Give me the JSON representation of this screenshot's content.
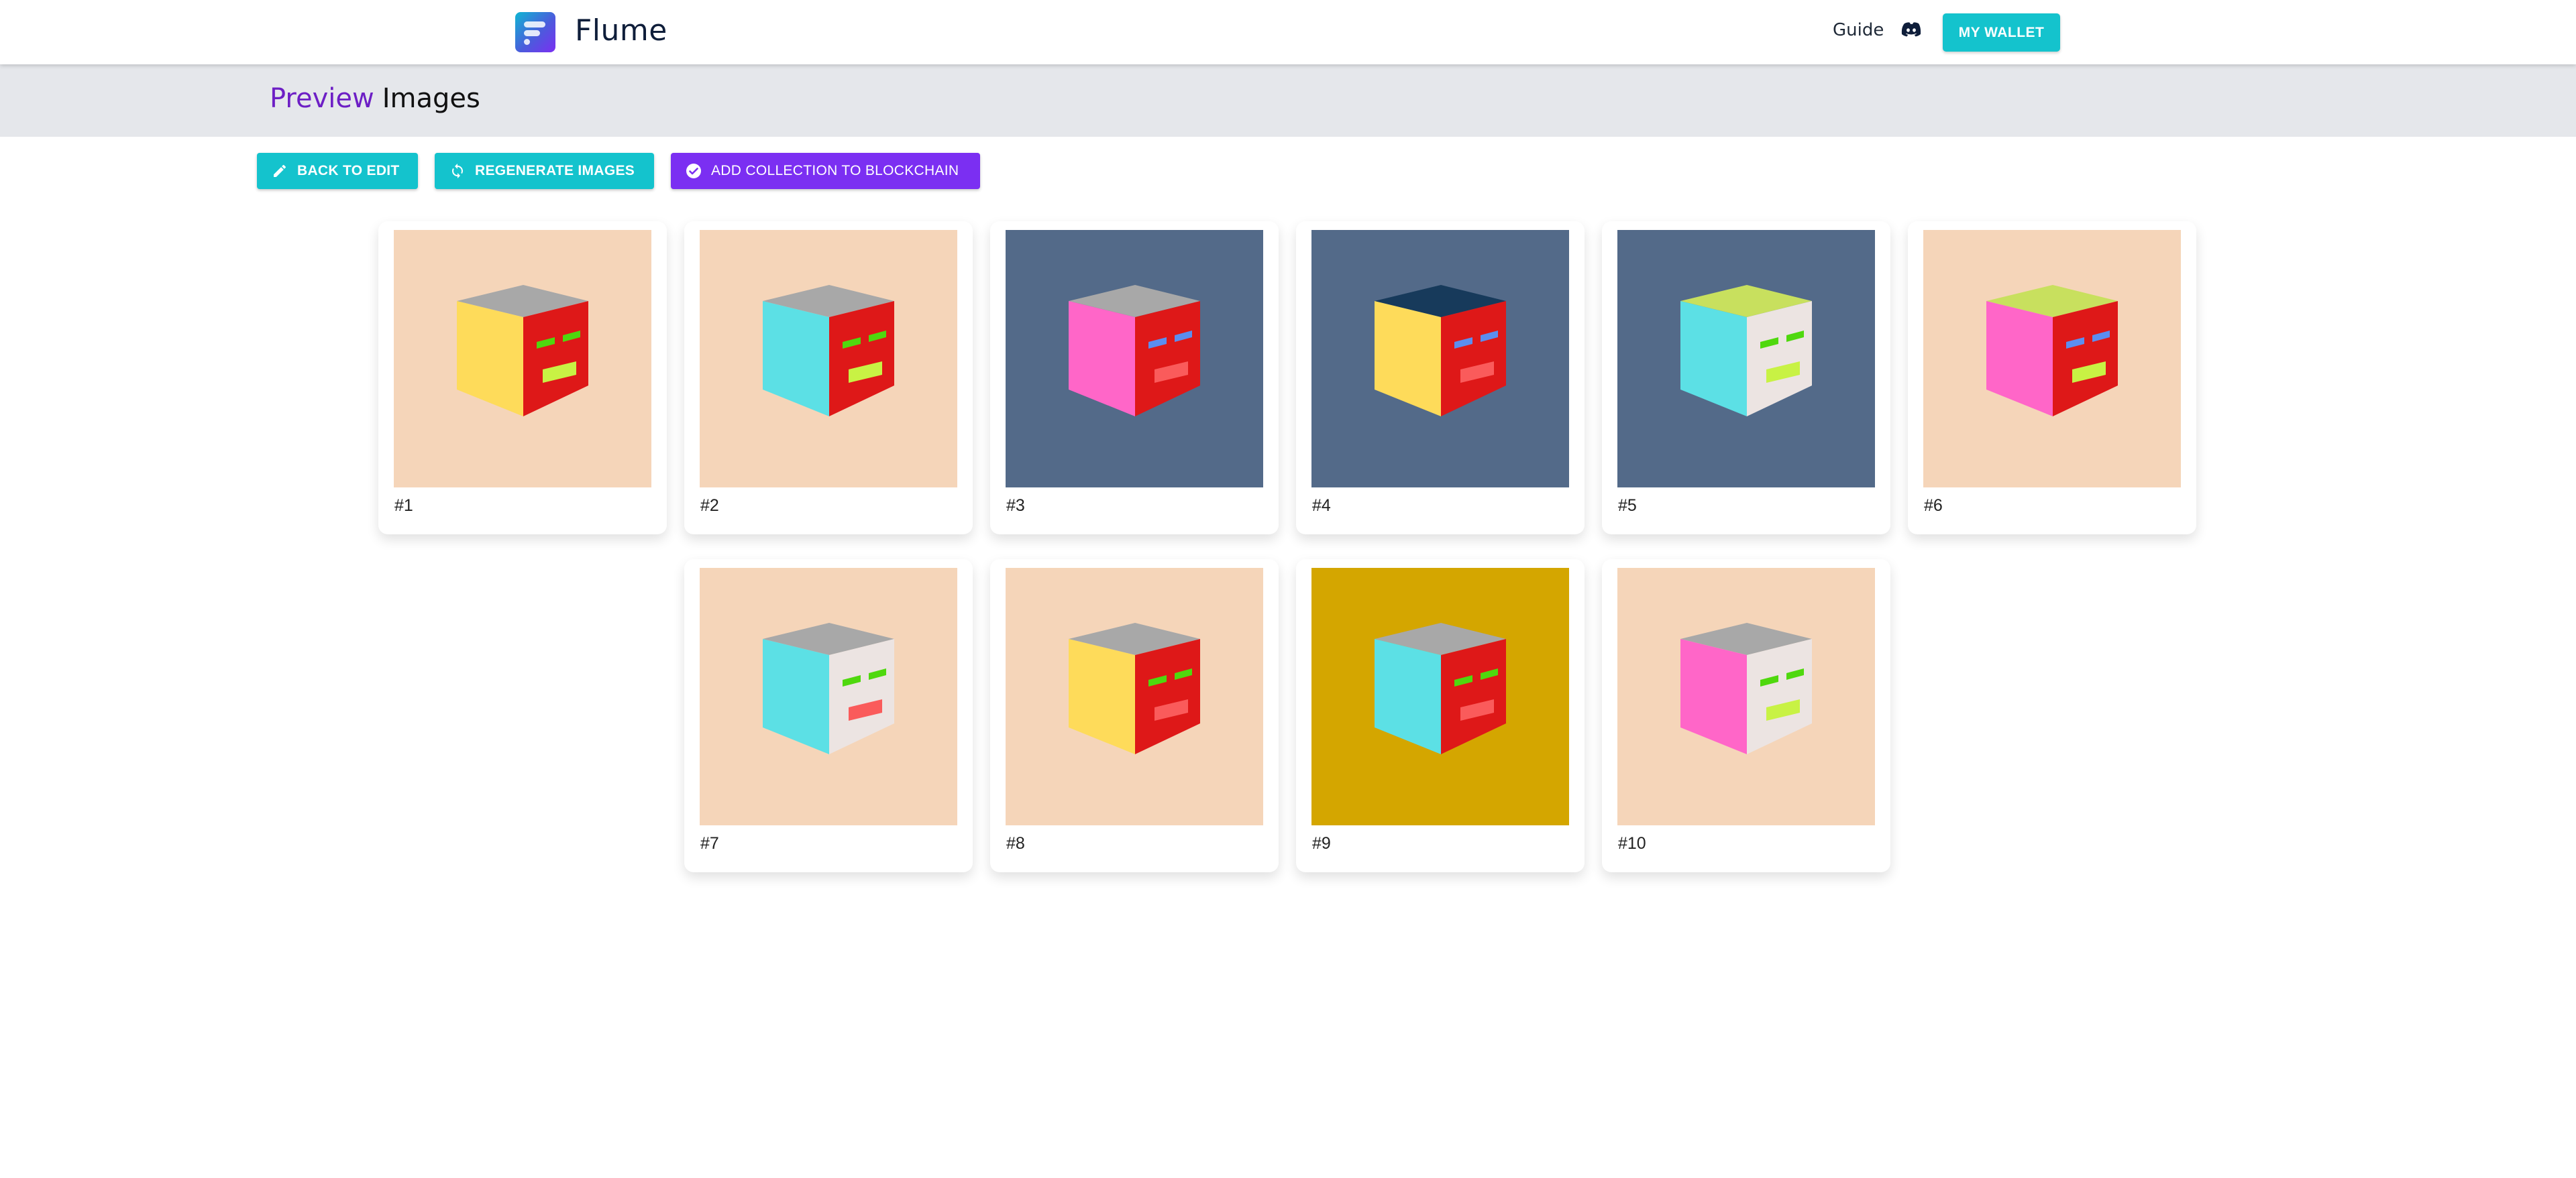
{
  "app": {
    "brand": "Flume",
    "nav": {
      "guide": "Guide",
      "discord_icon": "discord-icon",
      "wallet_button": "MY WALLET"
    }
  },
  "header": {
    "title_accent": "Preview",
    "title_rest": "Images"
  },
  "actions": {
    "back": {
      "label": "BACK TO EDIT",
      "icon": "pencil-icon"
    },
    "regenerate": {
      "label": "REGENERATE IMAGES",
      "icon": "refresh-icon"
    },
    "add_to_chain": {
      "label": "ADD COLLECTION TO BLOCKCHAIN",
      "icon": "check-circle-icon"
    }
  },
  "colors": {
    "teal": "#14c3cd",
    "purple": "#7b2ff2",
    "accent_text": "#6d1fc5",
    "subheader_bg": "#e5e7eb"
  },
  "images": [
    {
      "label": "#1",
      "bg": "#f5d5b9",
      "top": "#a8a8a8",
      "left": "#fedb5a",
      "right": "#de1818",
      "eyes": "#4fd80e",
      "mouth": "#c8f244"
    },
    {
      "label": "#2",
      "bg": "#f5d5b9",
      "top": "#a8a8a8",
      "left": "#5ce0e5",
      "right": "#de1818",
      "eyes": "#4fd80e",
      "mouth": "#c8f244"
    },
    {
      "label": "#3",
      "bg": "#536a89",
      "top": "#a8a8a8",
      "left": "#ff66c8",
      "right": "#de1818",
      "eyes": "#5b8ef0",
      "mouth": "#fa5b5b"
    },
    {
      "label": "#4",
      "bg": "#536a89",
      "top": "#173a5b",
      "left": "#fedb5a",
      "right": "#de1818",
      "eyes": "#5b8ef0",
      "mouth": "#fa5b5b"
    },
    {
      "label": "#5",
      "bg": "#536a89",
      "top": "#c8e05e",
      "left": "#5ce0e5",
      "right": "#ece4e2",
      "eyes": "#4fd80e",
      "mouth": "#c8f244"
    },
    {
      "label": "#6",
      "bg": "#f5d5b9",
      "top": "#c8e05e",
      "left": "#ff66c8",
      "right": "#de1818",
      "eyes": "#5b8ef0",
      "mouth": "#c8f244"
    },
    {
      "label": "#7",
      "bg": "#f5d5b9",
      "top": "#a8a8a8",
      "left": "#5ce0e5",
      "right": "#ece4e2",
      "eyes": "#4fd80e",
      "mouth": "#fa5b5b"
    },
    {
      "label": "#8",
      "bg": "#f5d5b9",
      "top": "#a8a8a8",
      "left": "#fedb5a",
      "right": "#de1818",
      "eyes": "#4fd80e",
      "mouth": "#fa5b5b"
    },
    {
      "label": "#9",
      "bg": "#d4a600",
      "top": "#a8a8a8",
      "left": "#5ce0e5",
      "right": "#de1818",
      "eyes": "#4fd80e",
      "mouth": "#fa5b5b"
    },
    {
      "label": "#10",
      "bg": "#f5d5b9",
      "top": "#a8a8a8",
      "left": "#ff66c8",
      "right": "#ece4e2",
      "eyes": "#4fd80e",
      "mouth": "#c8f244"
    }
  ]
}
